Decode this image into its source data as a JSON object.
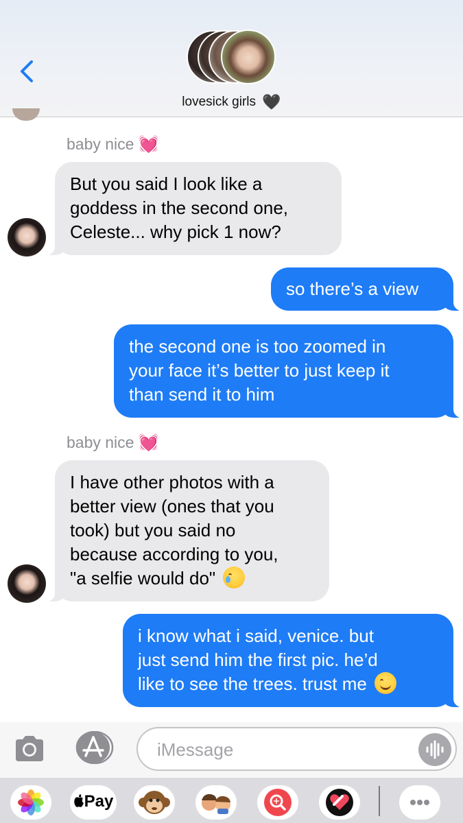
{
  "header": {
    "group_name": "lovesick girls",
    "group_emoji": "🖤"
  },
  "messages": [
    {
      "sender": "baby nice",
      "sender_emoji": "💓",
      "direction": "incoming",
      "lines": [
        "But you said I look like a",
        "goddess in the second one,",
        "Celeste... why pick 1 now?"
      ]
    },
    {
      "direction": "outgoing",
      "lines": [
        "so there’s a view"
      ]
    },
    {
      "direction": "outgoing",
      "lines": [
        "the second one is too zoomed in",
        "your face it’s better to just keep it",
        "than send it to him"
      ]
    },
    {
      "sender": "baby nice",
      "sender_emoji": "💓",
      "direction": "incoming",
      "lines": [
        "I have other photos with a",
        "better view (ones that you",
        "took) but you said no",
        "because according to you,",
        "\"a selfie would do\""
      ],
      "trailing_emoji": "crying-face"
    },
    {
      "direction": "outgoing",
      "lines": [
        "i know what i said, venice. but",
        "just send him the first pic. he’d",
        "like to see the trees. trust me"
      ],
      "trailing_emoji": "smiling-face"
    }
  ],
  "input": {
    "placeholder": "iMessage"
  },
  "app_drawer": {
    "apple_pay_label": "Pay",
    "apps": [
      "photos-icon",
      "apple-pay-icon",
      "monkey-memoji-icon",
      "memoji-stickers-icon",
      "web-search-icon",
      "digital-touch-icon",
      "more-apps-icon"
    ]
  },
  "colors": {
    "outgoing_bubble": "#1e7cf6",
    "incoming_bubble": "#e9e9eb",
    "back_chevron": "#1e7cf6"
  }
}
